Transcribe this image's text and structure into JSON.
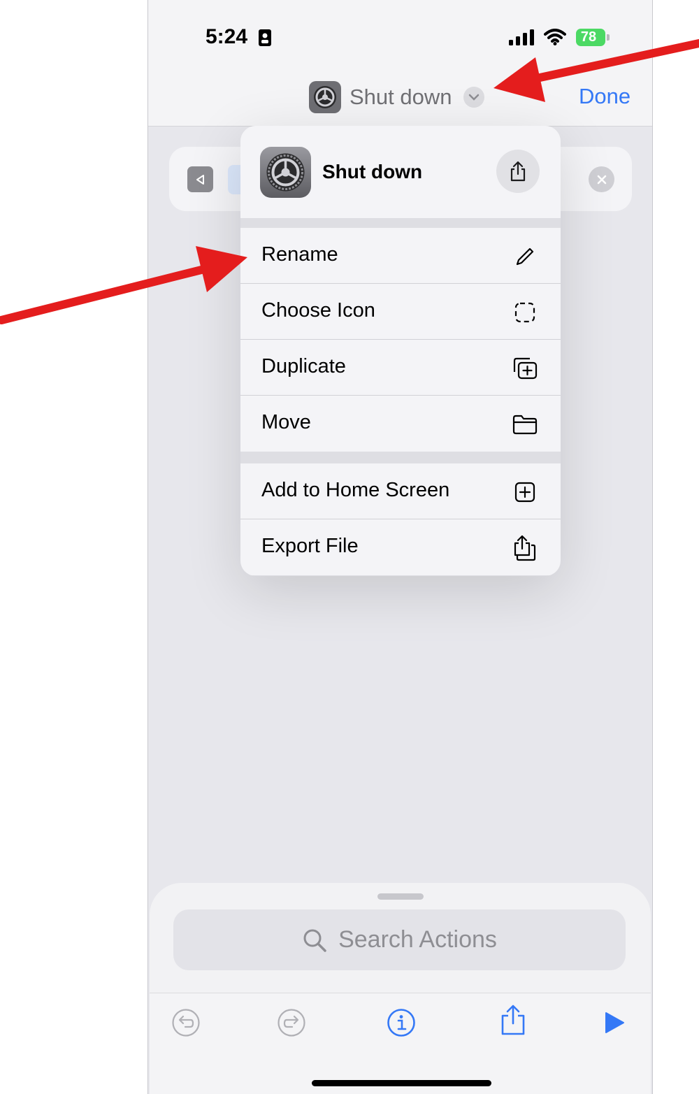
{
  "status_bar": {
    "time": "5:24",
    "battery": "78"
  },
  "nav": {
    "title": "Shut down",
    "done_label": "Done"
  },
  "menu": {
    "header_title": "Shut down",
    "group1": [
      {
        "label": "Rename",
        "icon": "pencil-icon"
      },
      {
        "label": "Choose Icon",
        "icon": "dashed-square-icon"
      },
      {
        "label": "Duplicate",
        "icon": "duplicate-plus-icon"
      },
      {
        "label": "Move",
        "icon": "folder-icon"
      }
    ],
    "group2": [
      {
        "label": "Add to Home Screen",
        "icon": "plus-square-icon"
      },
      {
        "label": "Export File",
        "icon": "share-doc-icon"
      }
    ]
  },
  "sheet": {
    "search_placeholder": "Search Actions"
  },
  "toolbar": [
    "undo-icon",
    "redo-icon",
    "info-icon",
    "share-icon",
    "play-icon"
  ],
  "colors": {
    "accent": "#3478f6",
    "annotation": "#e41d1d",
    "battery": "#4cd964"
  }
}
